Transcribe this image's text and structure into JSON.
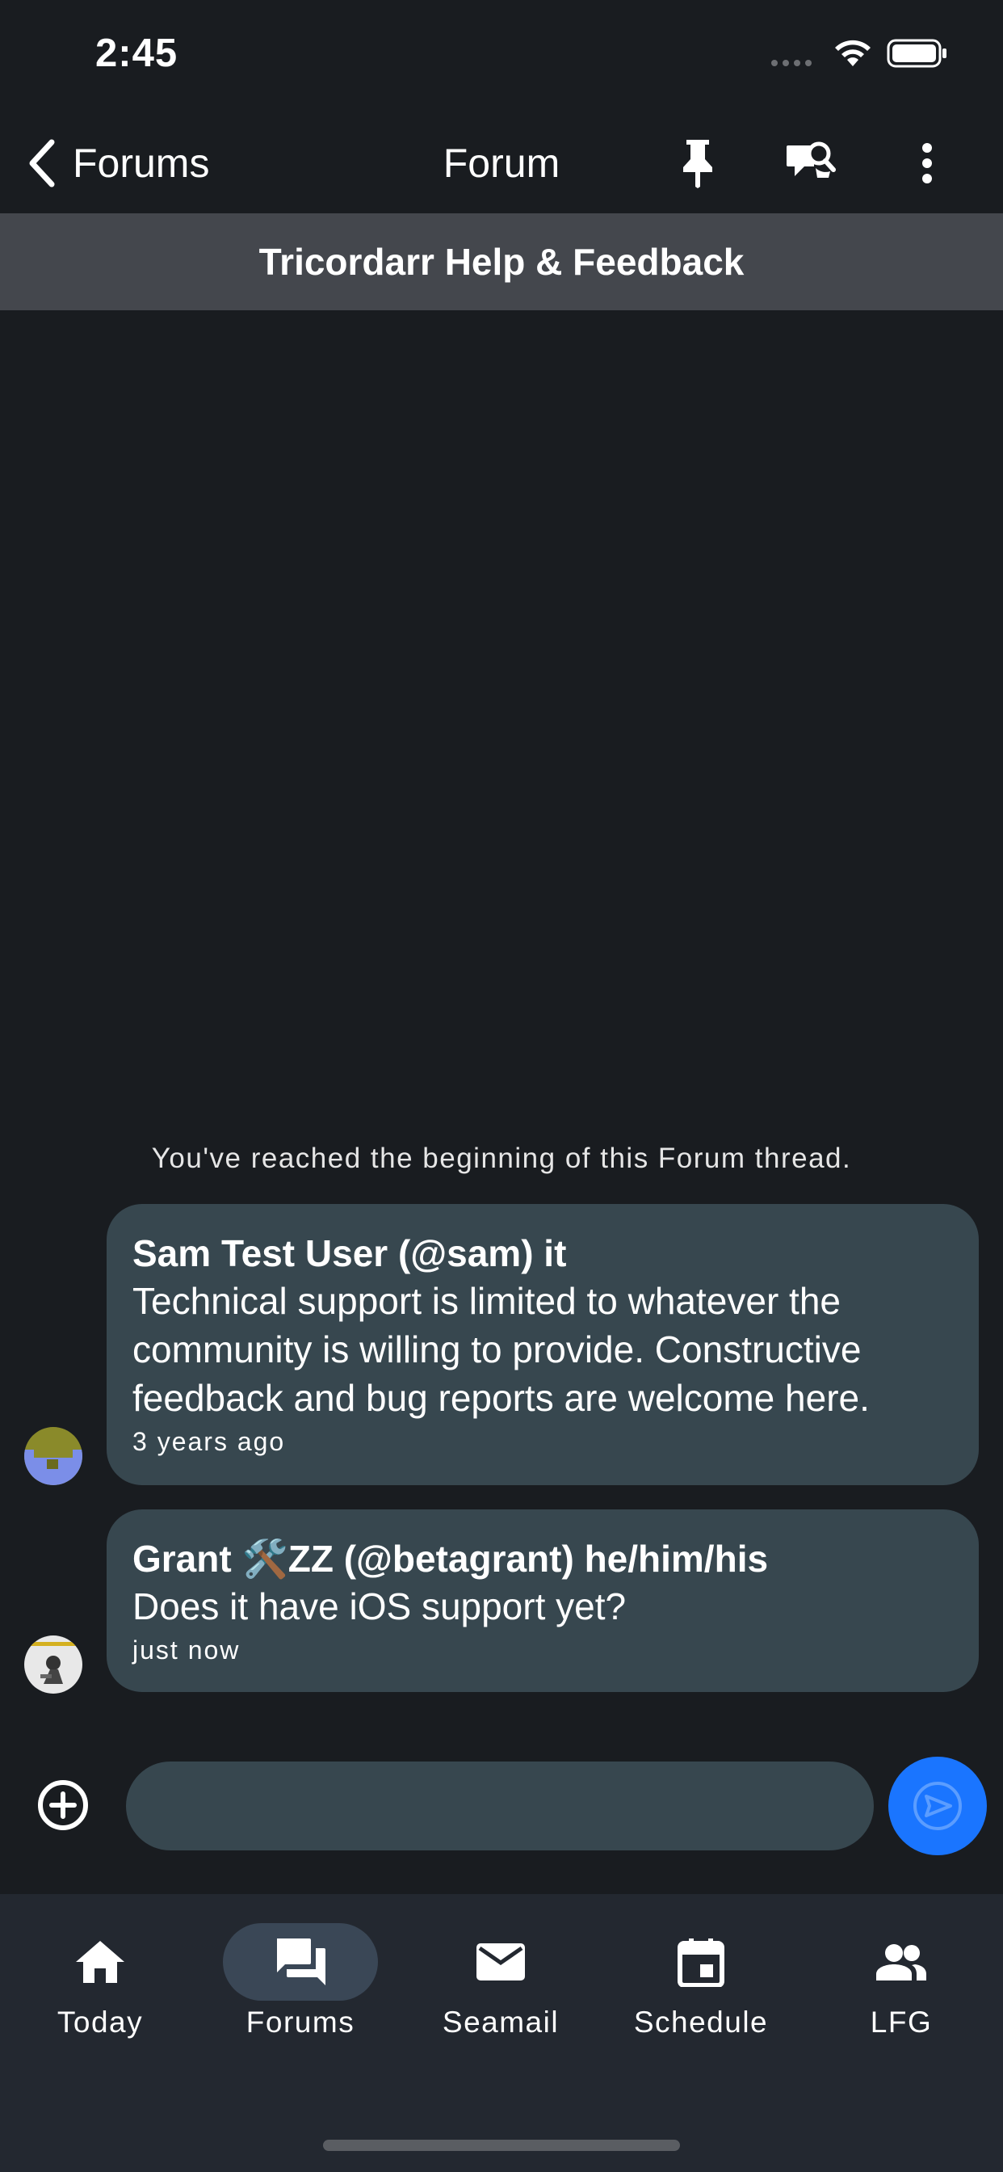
{
  "status_bar": {
    "time": "2:45"
  },
  "nav": {
    "back_label": "Forums",
    "title": "Forum",
    "icons": [
      "pin-icon",
      "search-forum-icon",
      "more-vert-icon"
    ]
  },
  "forum": {
    "title": "Tricordarr Help & Feedback"
  },
  "thread": {
    "beginning_text": "You've reached the beginning of this Forum thread.",
    "posts": [
      {
        "author": "Sam Test User (@sam) it",
        "text": "Technical support is limited to whatever the community is willing to provide. Constructive feedback and bug reports are welcome here.",
        "time": "3 years ago"
      },
      {
        "author": "Grant 🛠️ZZ (@betagrant) he/him/his",
        "text": "Does it have iOS support yet?",
        "time": "just now"
      }
    ]
  },
  "composer": {
    "value": "",
    "placeholder": ""
  },
  "tabs": [
    {
      "label": "Today",
      "icon": "home-icon",
      "active": false
    },
    {
      "label": "Forums",
      "icon": "forum-icon",
      "active": true
    },
    {
      "label": "Seamail",
      "icon": "mail-icon",
      "active": false
    },
    {
      "label": "Schedule",
      "icon": "calendar-icon",
      "active": false
    },
    {
      "label": "LFG",
      "icon": "people-icon",
      "active": false
    }
  ],
  "colors": {
    "background": "#191c20",
    "bubble": "#37474f",
    "header_bar": "#44474d",
    "tab_bar": "#232830",
    "accent": "#1a75ff"
  }
}
